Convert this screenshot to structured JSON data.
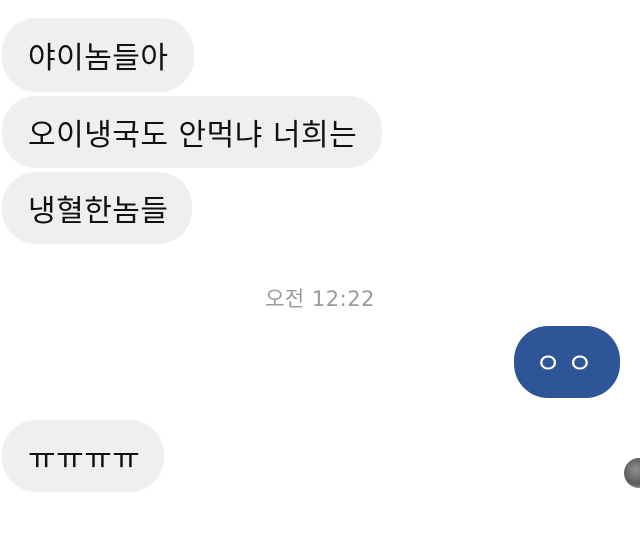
{
  "messages": [
    {
      "sender": "other",
      "text": "야이놈들아"
    },
    {
      "sender": "other",
      "text": "오이냉국도 안먹냐 너희는"
    },
    {
      "sender": "other",
      "text": "냉혈한놈들"
    },
    {
      "sender": "me",
      "text": "ㅇㅇ"
    },
    {
      "sender": "other",
      "text": "ㅠㅠㅠㅠ"
    }
  ],
  "timestamp": "오전 12:22",
  "colors": {
    "incoming_bubble": "#efefef",
    "outgoing_bubble": "#2f5599",
    "timestamp_text": "#9a9a9a"
  }
}
